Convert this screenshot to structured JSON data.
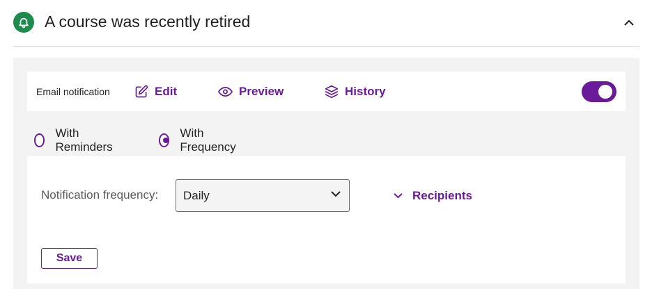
{
  "header": {
    "title": "A course was recently retired",
    "icon": "bell-icon",
    "icon_bg_color": "#1e8a4c",
    "collapse_icon": "chevron-up-icon"
  },
  "toolbar": {
    "label": "Email notification",
    "actions": [
      {
        "label": "Edit",
        "icon": "edit-icon"
      },
      {
        "label": "Preview",
        "icon": "eye-icon"
      },
      {
        "label": "History",
        "icon": "layers-icon"
      }
    ],
    "toggle_on": true
  },
  "mode": {
    "options": [
      {
        "label": "With Reminders",
        "checked": false
      },
      {
        "label": "With Frequency",
        "checked": true
      }
    ]
  },
  "form": {
    "frequency_label": "Notification frequency:",
    "frequency_value": "Daily",
    "recipients_label": "Recipients",
    "save_label": "Save"
  },
  "colors": {
    "accent": "#6a1b9a",
    "panel_bg": "#f3f3f3"
  }
}
